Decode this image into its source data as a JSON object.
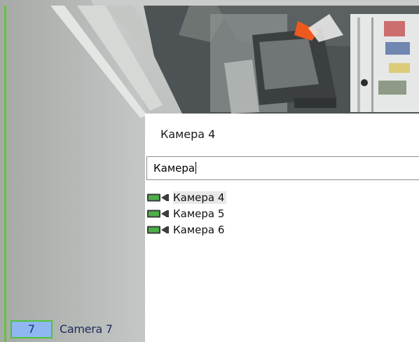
{
  "popup": {
    "title": "Камера 4",
    "search": {
      "value": "Камера"
    },
    "items": [
      {
        "label": "Камера 4",
        "icon": "camera-icon",
        "selected": true
      },
      {
        "label": "Камера 5",
        "icon": "camera-icon",
        "selected": false
      },
      {
        "label": "Камера 6",
        "icon": "camera-icon",
        "selected": false
      }
    ]
  },
  "video_cell": {
    "number": "7",
    "name": "Camera 7"
  },
  "colors": {
    "cell_border": "#4fc23a",
    "cell_badge_fill": "#8fb7f0",
    "popup_bg": "#ffffff"
  }
}
